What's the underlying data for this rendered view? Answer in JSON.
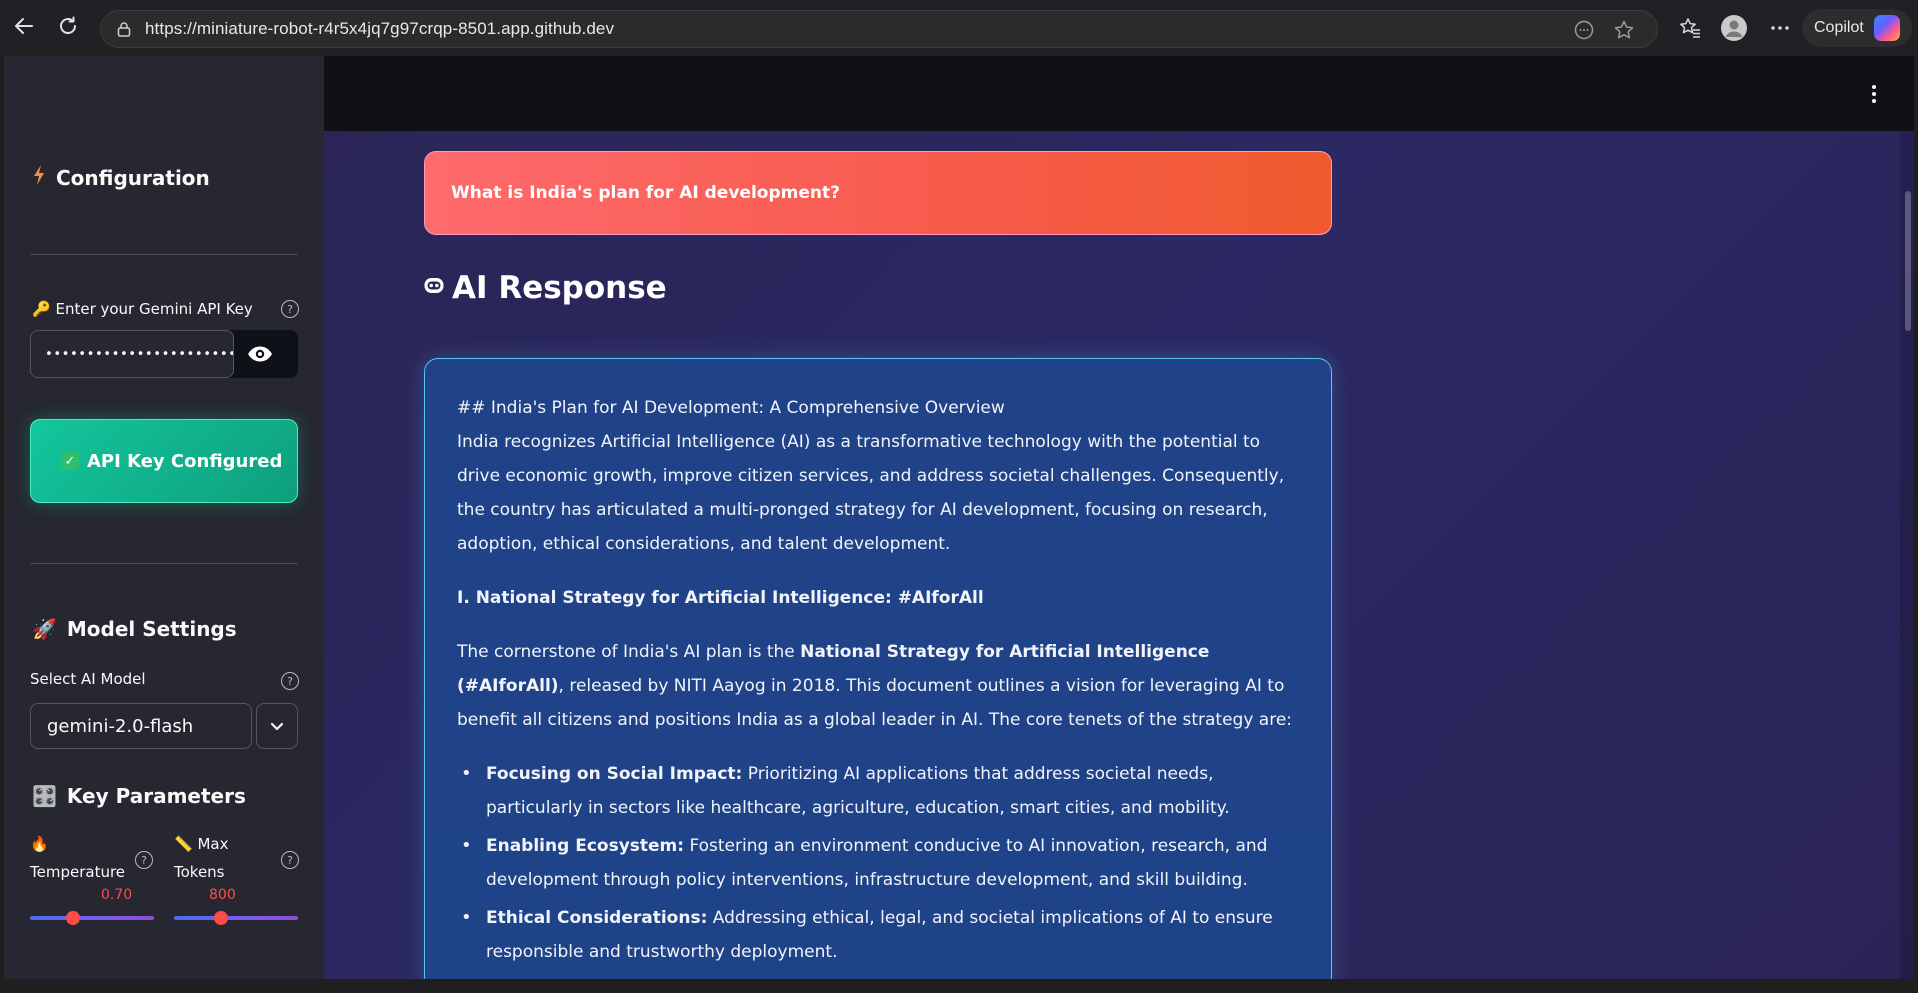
{
  "browser": {
    "url": "https://miniature-robot-r4r5x4jq7g97crqp-8501.app.github.dev",
    "copilot_label": "Copilot"
  },
  "sidebar": {
    "config_heading": "Configuration",
    "api_key_label": "Enter your Gemini API Key",
    "api_key_value": "••••••••••••••••••••••••••••••••",
    "status_text": "API Key Configured",
    "model_settings_heading": "Model Settings",
    "select_model_label": "Select AI Model",
    "model_value": "gemini-2.0-flash",
    "key_params_heading": "Key Parameters",
    "temperature_label_line1": "🔥",
    "temperature_label_line2": "Temperature",
    "temperature_value": "0.70",
    "temperature_fraction": 0.35,
    "max_tokens_label_line1": "📏 Max",
    "max_tokens_label_line2": "Tokens",
    "max_tokens_value": "800",
    "max_tokens_fraction": 0.38,
    "help_glyph": "?"
  },
  "main": {
    "question": "What is India's plan for AI development?",
    "response_heading": "AI Response",
    "response": {
      "heading_line": "## India's Plan for AI Development: A Comprehensive Overview",
      "intro": "India recognizes Artificial Intelligence (AI) as a transformative technology with the potential to drive economic growth, improve citizen services, and address societal challenges. Consequently, the country has articulated a multi-pronged strategy for AI development, focusing on research, adoption, ethical considerations, and talent development.",
      "section_title": "I. National Strategy for Artificial Intelligence: #AIforAll",
      "para_start": "The cornerstone of India's AI plan is the ",
      "para_bold": "National Strategy for Artificial Intelligence (#AIforAll)",
      "para_end": ", released by NITI Aayog in 2018. This document outlines a vision for leveraging AI to benefit all citizens and positions India as a global leader in AI. The core tenets of the strategy are:",
      "bullets": [
        {
          "title": "Focusing on Social Impact:",
          "text": " Prioritizing AI applications that address societal needs, particularly in sectors like healthcare, agriculture, education, smart cities, and mobility."
        },
        {
          "title": "Enabling Ecosystem:",
          "text": " Fostering an environment conducive to AI innovation, research, and development through policy interventions, infrastructure development, and skill building."
        },
        {
          "title": "Ethical Considerations:",
          "text": " Addressing ethical, legal, and societal implications of AI to ensure responsible and trustworthy deployment."
        }
      ]
    }
  },
  "colors": {
    "accent_red": "#ff4b4b",
    "status_green": "#14c69c",
    "question_gradient_start": "#ff6a6e",
    "card_border": "#57c4f2"
  }
}
